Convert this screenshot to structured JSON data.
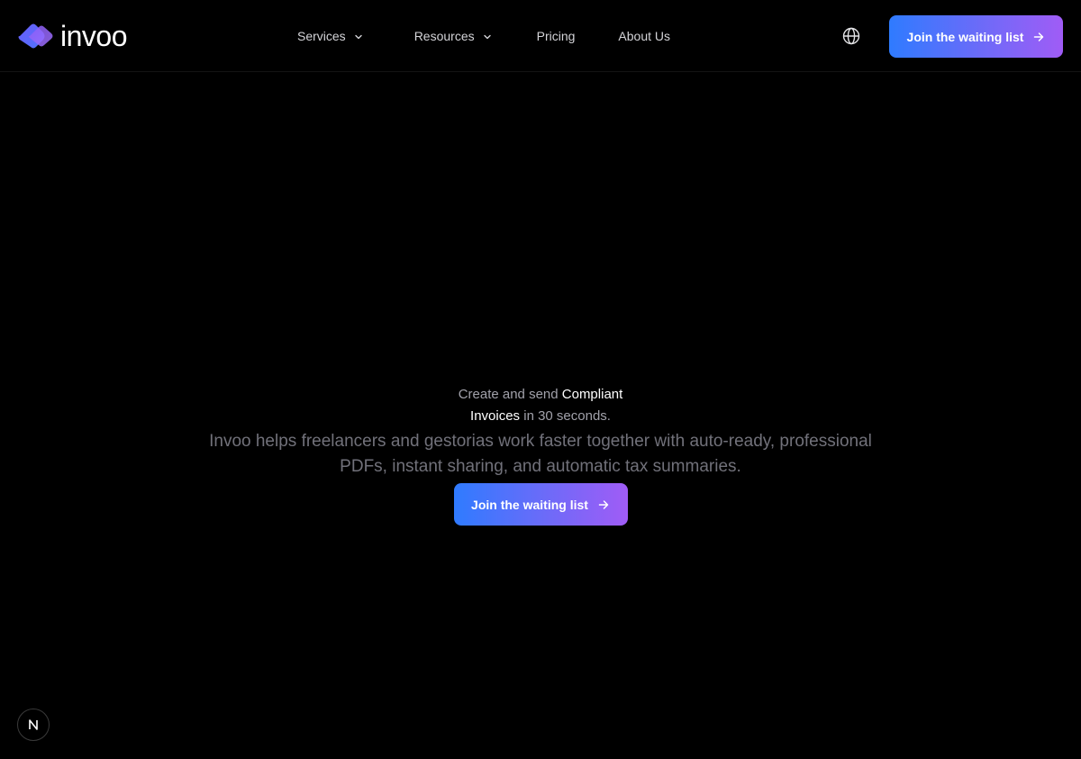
{
  "brand": {
    "name": "invoo",
    "colors": {
      "background": "#000000",
      "accent_start": "#2f7bff",
      "accent_end": "#a05cf6"
    }
  },
  "nav": {
    "items": [
      {
        "label": "Services",
        "has_dropdown": true
      },
      {
        "label": "Resources",
        "has_dropdown": true
      },
      {
        "label": "Pricing",
        "has_dropdown": false
      },
      {
        "label": "About Us",
        "has_dropdown": false
      }
    ]
  },
  "header": {
    "language_icon": "globe-icon",
    "cta_label": "Join the waiting list",
    "cta_icon": "arrow-right-icon"
  },
  "hero": {
    "title_part1": "Create and send ",
    "title_highlight1": "Compliant",
    "title_highlight2": "Invoices",
    "title_part2": " in 30 seconds.",
    "subtitle": "Invoo helps freelancers and gestorias work faster together with auto-ready, professional PDFs, instant sharing, and automatic tax summaries.",
    "cta_label": "Join the waiting list",
    "cta_icon": "arrow-right-icon"
  },
  "corner_badge": {
    "icon": "n-logo-icon"
  }
}
